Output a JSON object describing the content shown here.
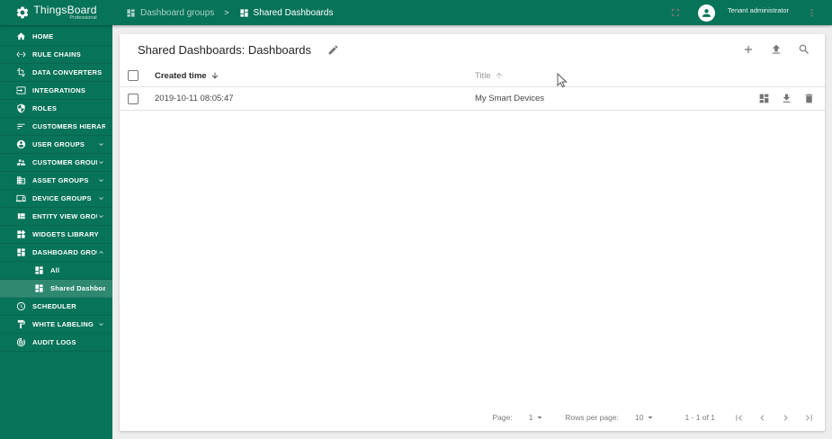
{
  "colors": {
    "primary": "#077358",
    "selected": "#2f8970",
    "page-bg": "#eeeeee",
    "card-bg": "#ffffff",
    "icon-gray": "#757575",
    "border": "#e0e0e0"
  },
  "brand": {
    "name": "ThingsBoard",
    "tagline": "Professional"
  },
  "breadcrumb": {
    "separator": ">",
    "items": [
      {
        "label": "Dashboard groups",
        "icon": "dashboard-icon"
      },
      {
        "label": "Shared Dashboards",
        "icon": "dashboard-icon"
      }
    ]
  },
  "topbar": {
    "user": "Tenant administrator"
  },
  "sidebar": {
    "items": [
      {
        "label": "HOME",
        "icon": "home-icon"
      },
      {
        "label": "RULE CHAINS",
        "icon": "rule-chains-icon"
      },
      {
        "label": "DATA CONVERTERS",
        "icon": "data-converters-icon"
      },
      {
        "label": "INTEGRATIONS",
        "icon": "integrations-icon"
      },
      {
        "label": "ROLES",
        "icon": "roles-icon"
      },
      {
        "label": "CUSTOMERS HIERARCHY",
        "icon": "customers-hierarchy-icon"
      },
      {
        "label": "USER GROUPS",
        "icon": "user-groups-icon",
        "expandable": true
      },
      {
        "label": "CUSTOMER GROUPS",
        "icon": "customer-groups-icon",
        "expandable": true
      },
      {
        "label": "ASSET GROUPS",
        "icon": "asset-groups-icon",
        "expandable": true
      },
      {
        "label": "DEVICE GROUPS",
        "icon": "device-groups-icon",
        "expandable": true
      },
      {
        "label": "ENTITY VIEW GROUPS",
        "icon": "entity-view-groups-icon",
        "expandable": true
      },
      {
        "label": "WIDGETS LIBRARY",
        "icon": "widgets-library-icon"
      },
      {
        "label": "DASHBOARD GROUPS",
        "icon": "dashboard-groups-icon",
        "expanded": true,
        "children": [
          {
            "label": "All"
          },
          {
            "label": "Shared Dashboards",
            "selected": true
          }
        ]
      },
      {
        "label": "SCHEDULER",
        "icon": "scheduler-icon"
      },
      {
        "label": "WHITE LABELING",
        "icon": "white-labeling-icon",
        "expandable": true
      },
      {
        "label": "AUDIT LOGS",
        "icon": "audit-logs-icon"
      }
    ]
  },
  "card": {
    "title": "Shared Dashboards: Dashboards"
  },
  "table": {
    "columns": [
      {
        "label": "Created time",
        "sort": "desc"
      },
      {
        "label": "Title",
        "sort": "asc"
      }
    ],
    "rows": [
      {
        "created_time": "2019-10-11 08:05:47",
        "title": "My Smart Devices"
      }
    ]
  },
  "pagination": {
    "page_label": "Page:",
    "page_value": "1",
    "rows_per_page_label": "Rows per page:",
    "rows_per_page_value": "10",
    "range": "1 - 1 of 1"
  }
}
